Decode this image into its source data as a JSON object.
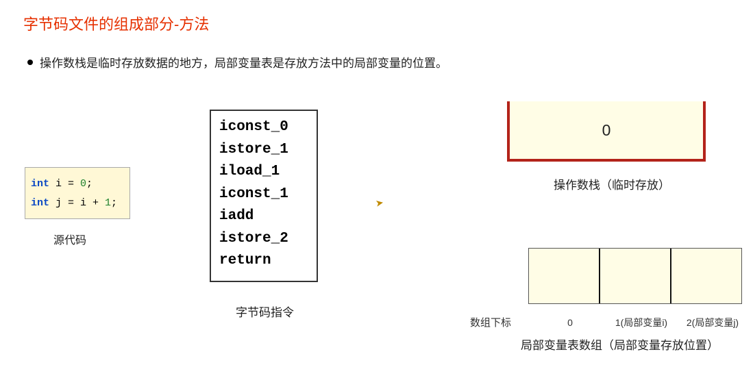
{
  "title": "字节码文件的组成部分-方法",
  "bullet": "操作数栈是临时存放数据的地方，局部变量表是存放方法中的局部变量的位置。",
  "source": {
    "line1": {
      "kw": "int",
      "rest": " i = ",
      "num": "0",
      "end": ";"
    },
    "line2": {
      "kw": "int",
      "rest": " j = i + ",
      "num": "1",
      "end": ";"
    },
    "label": "源代码"
  },
  "bytecode": {
    "lines": [
      "iconst_0",
      "istore_1",
      "iload_1",
      "iconst_1",
      "iadd",
      "istore_2",
      "return"
    ],
    "label": "字节码指令"
  },
  "stack": {
    "value": "0",
    "label": "操作数栈（临时存放）"
  },
  "array": {
    "indexPrefix": "数组下标",
    "indices": [
      "0",
      "1(局部变量i)",
      "2(局部变量j)"
    ],
    "label": "局部变量表数组（局部变量存放位置）"
  }
}
